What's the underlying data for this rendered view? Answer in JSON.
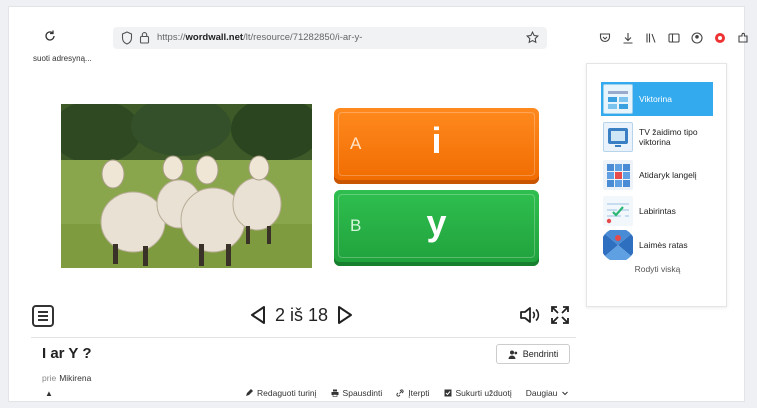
{
  "browser": {
    "url_prefix": "https://",
    "url_domain": "wordwall.net",
    "url_path": "/lt/resource/71282850/i-ar-y-",
    "bookmark_text": "suoti adresyną..."
  },
  "game": {
    "answers": [
      {
        "letter": "A",
        "text": "i",
        "color": "#f37a0d"
      },
      {
        "letter": "B",
        "text": "y",
        "color": "#27b044"
      }
    ],
    "current_page": "2",
    "page_separator": "iš",
    "total_pages": "18"
  },
  "resource": {
    "title": "I ar Y ?",
    "share_label": "Bendrinti",
    "author_prefix": "prie",
    "author_name": "Mikirena",
    "actions": [
      "Redaguoti turinį",
      "Spausdinti",
      "Įterpti",
      "Sukurti užduotį",
      "Daugiau"
    ]
  },
  "templates": {
    "items": [
      {
        "label": "Viktorina",
        "icon": "quiz-icon",
        "active": true
      },
      {
        "label": "TV žaidimo tipo viktorina",
        "icon": "tv-quiz-icon",
        "active": false
      },
      {
        "label": "Atidaryk langelį",
        "icon": "open-box-icon",
        "active": false
      },
      {
        "label": "Labirintas",
        "icon": "maze-icon",
        "active": false
      },
      {
        "label": "Laimės ratas",
        "icon": "wheel-icon",
        "active": false
      }
    ],
    "show_all": "Rodyti viską"
  },
  "colors": {
    "accent": "#33aaee",
    "answer_a": "#f37a0d",
    "answer_b": "#27b044"
  }
}
